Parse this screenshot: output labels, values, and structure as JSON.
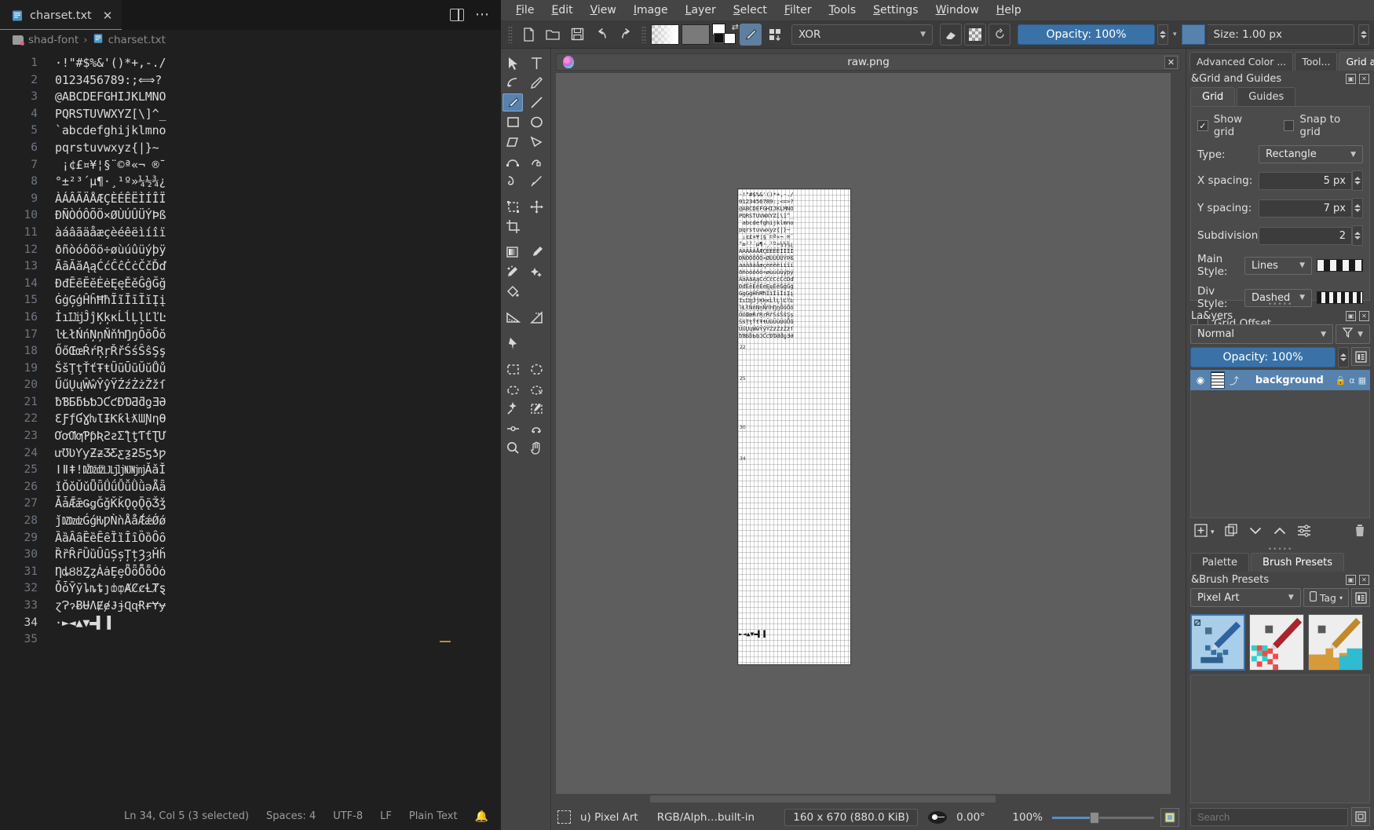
{
  "editor": {
    "tab": {
      "filename": "charset.txt",
      "close_label": "✕"
    },
    "breadcrumb": {
      "project": "shad-font",
      "separator": "›",
      "file": "charset.txt"
    },
    "lines": [
      {
        "n": "1",
        "text": "·!\"#$%&'()*+,-./"
      },
      {
        "n": "2",
        "text": "0123456789:;⟺?"
      },
      {
        "n": "3",
        "text": "@ABCDEFGHIJKLMNO"
      },
      {
        "n": "4",
        "text": "PQRSTUVWXYZ[\\]^_"
      },
      {
        "n": "5",
        "text": "`abcdefghijklmno"
      },
      {
        "n": "6",
        "text": "pqrstuvwxyz{|}~"
      },
      {
        "n": "7",
        "text": " ¡¢£¤¥¦§¨©ª«¬ ®¯"
      },
      {
        "n": "8",
        "text": "°±²³´µ¶·¸¹º»¼½¾¿"
      },
      {
        "n": "9",
        "text": "ÀÁÂÃÄÅÆÇÈÉÊËÌÍÎÏ"
      },
      {
        "n": "10",
        "text": "ÐÑÒÓÔÕÖ×ØÙÚÛÜÝÞß"
      },
      {
        "n": "11",
        "text": "àáâãäåæçèéêëìíîï"
      },
      {
        "n": "12",
        "text": "ðñòóôõö÷øùúûüýþÿ"
      },
      {
        "n": "13",
        "text": "ĀāĂăĄąĆćĈĉĊċČčĎď"
      },
      {
        "n": "14",
        "text": "ĐđĒēĔĕĖėĘęĚěĜĝĞğ"
      },
      {
        "n": "15",
        "text": "ĠġĢģĤĥĦħĨĩĪīĬĭĮį"
      },
      {
        "n": "16",
        "text": "İıĲĳĴĵĶķĸĹĺĻļĽľĿ"
      },
      {
        "n": "17",
        "text": "ŀŁłŃńŅņŇňŉŊŋŌōŎŏ"
      },
      {
        "n": "18",
        "text": "ŐőŒœŔŕŖŗŘřŚśŜŝŞş"
      },
      {
        "n": "19",
        "text": "ŠšŢţŤťŦŧŨũŪūŬŭŮů"
      },
      {
        "n": "20",
        "text": "ŰűŲųŴŵŶŷŸŹźŻżŽžſ"
      },
      {
        "n": "21",
        "text": "ƀƁƂƃƄƅƆƇƈƉƊƋƌƍƎƏ"
      },
      {
        "n": "22",
        "text": "ƐƑƒƓƔƕƖƗƘƙƚƛƜƝƞƟ"
      },
      {
        "n": "23",
        "text": "ƠơƢƣƤƥƦƧƨƩƪƫƬƭƮƯ"
      },
      {
        "n": "24",
        "text": "ưƱƲƳƴƵƶƷƸƹƺƻƼƽƾƿ"
      },
      {
        "n": "25",
        "text": "ǀǁǂǃǄǅǆǇǈǉǊǋǌǍǎǏ"
      },
      {
        "n": "26",
        "text": "ǐǑǒǓǔǕǖǗǘǙǚǛǜǝǞǟ"
      },
      {
        "n": "27",
        "text": "ǠǡǢǣǤǥǦǧǨǩǪǫǬǭǮǯ"
      },
      {
        "n": "28",
        "text": "ǰǱǲǳǴǵǶǷǸǹǺǻǼǽǾǿ"
      },
      {
        "n": "29",
        "text": "ȀȁȂȃȄȅȆȇȈȉȊȋȌȍȎȏ"
      },
      {
        "n": "30",
        "text": "ȐȑȒȓȔȕȖȗȘșȚțȜȝȞȟ"
      },
      {
        "n": "31",
        "text": "ȠȡȢȣȤȥȦȧȨȩȪȫȬȭȮȯ"
      },
      {
        "n": "32",
        "text": "ȰȱȲȳȴȵȶȷȸȹȺȻȼȽȾȿ"
      },
      {
        "n": "33",
        "text": "ɀɁɂɃɄɅɆɇɈɉɊɋɌɍɎɏ"
      },
      {
        "n": "34",
        "text": "·►◄▲▼▬▌▐"
      },
      {
        "n": "35",
        "text": ""
      }
    ],
    "active_line": "34",
    "status": {
      "cursor": "Ln 34, Col 5 (3 selected)",
      "spaces": "Spaces: 4",
      "encoding": "UTF-8",
      "eol": "LF",
      "language": "Plain Text",
      "bell": "bell-icon"
    }
  },
  "gimp": {
    "menu": [
      "File",
      "Edit",
      "View",
      "Image",
      "Layer",
      "Select",
      "Filter",
      "Tools",
      "Settings",
      "Window",
      "Help"
    ],
    "toolbar": {
      "new_icon": "new-file-icon",
      "open_icon": "open-folder-icon",
      "save_icon": "save-icon",
      "undo_icon": "undo-icon",
      "redo_icon": "redo-icon",
      "gradient_swatch": "gradient-swatch",
      "pattern_swatch": "pattern-swatch",
      "fgbg_icon": "foreground-background-colors",
      "brush_icon": "brush-icon",
      "tool_options_icon": "tool-options-icon",
      "blend_mode": "XOR",
      "eraser_icon": "eraser-icon",
      "checker_icon": "transparency-checker-icon",
      "reset_icon": "reset-icon",
      "opacity_label": "Opacity: 100%",
      "size_label": "Size: 1.00 px"
    },
    "tools": [
      "move-select-icon",
      "text-tool-icon",
      "path-tool-icon",
      "ink-tool-icon",
      "paintbrush-tool-icon",
      "line-tool-icon",
      "rectangle-tool-icon",
      "ellipse-tool-icon",
      "polygon-tool-icon",
      "polyline-tool-icon",
      "bezier-tool-icon",
      "freehand-path-icon",
      "curve-tool-icon",
      "dynamic-brush-icon",
      "transform-tool-icon",
      "move-tool-icon",
      "crop-tool-icon",
      "gradient-tool-icon",
      "color-picker-icon",
      "smudge-tool-icon",
      "sparkle-tool-icon",
      "bucket-fill-icon",
      "measure-tool-icon",
      "angle-tool-icon",
      "reference-pin-icon",
      "rect-select-icon",
      "ellipse-select-icon",
      "freehand-select-icon",
      "polygon-select-icon",
      "magic-wand-icon",
      "similar-color-select-icon",
      "bezier-select-icon",
      "magnetic-select-icon",
      "zoom-tool-icon",
      "pan-tool-icon"
    ],
    "selected_tool": "paintbrush-tool-icon",
    "canvas": {
      "image_title": "raw.png",
      "close_label": "✕",
      "wilber_icon": "app-logo-icon",
      "glyph_rows": [
        "·!\"#$%&'()*+,-./",
        "0123456789:;<=>?",
        "@ABCDEFGHIJKLMNO",
        "PQRSTUVWXYZ[\\]^_",
        "`abcdefghijklmno",
        "pqrstuvwxyz{|}~",
        " ¡¢£¤¥¦§¨©ª«¬ ®¯",
        "°±²³´µ¶·¸¹º»¼½¾¿",
        "ÀÁÂÃÄÅÆÇÈÉÊËÌÍÎÏ",
        "ÐÑÒÓÔÕÖ×ØÙÚÛÜÝÞß",
        "àáâãäåæçèéêëìíîï",
        "ðñòóôõö÷øùúûüýþÿ",
        "ĀāĂăĄąĆćĈĉĊċČčĎď",
        "ĐđĒēĔĕĖėĘęĚěĜĝĞğ",
        "ĠġĢģĤĥĦħĨĩĪīĬĭĮį",
        "İıĲĳĴĵĶķĸĹĺĻļĽľĿ",
        "ŀŁłŃńŅņŇňŉŊŋŌōŎŏ",
        "ŐőŒœŔŕŖŗŘřŚśŜŝŞş",
        "ŠšŢţŤťŦŧŨũŪūŬŭŮů",
        "ŰűŲųŴŵŶŷŸŹźŻżŽžſ",
        "ƀƁƂƃƄƅƆƇƈƉƊƋƌƍƎƏ"
      ],
      "last_row": "►◄▲▼▬▌▐",
      "margin_marks": [
        "22",
        "25",
        "30",
        "34"
      ]
    },
    "status": {
      "selection_icon": "selection-icon",
      "brush": "u) Pixel Art",
      "mode": "RGB/Alph…built-in",
      "dimensions": "160 x 670 (880.0 KiB)",
      "pointer_icon": "pointer-icon",
      "angle": "0.00°",
      "zoom": "100%"
    },
    "docks": {
      "tabs": [
        {
          "label": "Advanced Color ...",
          "active": false
        },
        {
          "label": "Tool...",
          "active": false
        },
        {
          "label": "Grid an...",
          "active": true
        }
      ],
      "grid_panel": {
        "title": "&Grid and Guides",
        "subtabs": [
          {
            "label": "Grid",
            "active": true
          },
          {
            "label": "Guides",
            "active": false
          }
        ],
        "show_grid": {
          "label": "Show grid",
          "checked": true
        },
        "snap_to_grid": {
          "label": "Snap to grid",
          "checked": false
        },
        "type": {
          "label": "Type:",
          "value": "Rectangle"
        },
        "x_spacing": {
          "label": "X spacing:",
          "value": "5 px"
        },
        "y_spacing": {
          "label": "Y spacing:",
          "value": "7 px"
        },
        "subdivision": {
          "label": "Subdivision:",
          "value": "2"
        },
        "main_style": {
          "label": "Main Style:",
          "value": "Lines"
        },
        "div_style": {
          "label": "Div Style:",
          "value": "Dashed"
        },
        "grid_offset": {
          "label": "Grid Offset",
          "checked": false
        }
      },
      "layers_panel": {
        "title": "La&yers",
        "mode": "Normal",
        "filter_icon": "filter-icon",
        "opacity_label": "Opacity:  100%",
        "layers": [
          {
            "name": "background",
            "visible_icon": "eye-icon",
            "link_icon": "link-icon",
            "lock_icon": "lock-icon",
            "alpha_icon": "alpha-icon",
            "mask_icon": "mask-icon"
          }
        ],
        "toolbar": [
          "new-layer-icon",
          "duplicate-layer-icon",
          "lower-layer-icon",
          "raise-layer-icon",
          "layer-options-icon",
          "delete-layer-icon"
        ]
      },
      "brush_panel": {
        "tabs": [
          {
            "label": "Palette",
            "active": false
          },
          {
            "label": "Brush Presets",
            "active": true
          }
        ],
        "title": "&Brush Presets",
        "preset_group": "Pixel Art",
        "tag_label": "Tag",
        "list_icon": "list-view-icon",
        "brushes": [
          {
            "name": "pixel-art-blue-brush",
            "selected": true
          },
          {
            "name": "pixel-art-red-brush",
            "selected": false
          },
          {
            "name": "pixel-art-gold-brush",
            "selected": false
          }
        ],
        "search_placeholder": "Search"
      }
    }
  },
  "colors": {
    "accent_blue": "#5682ad",
    "editor_bg": "#1f1f1f",
    "gimp_bg": "#454545",
    "tab_underline": "#2db4a0"
  }
}
